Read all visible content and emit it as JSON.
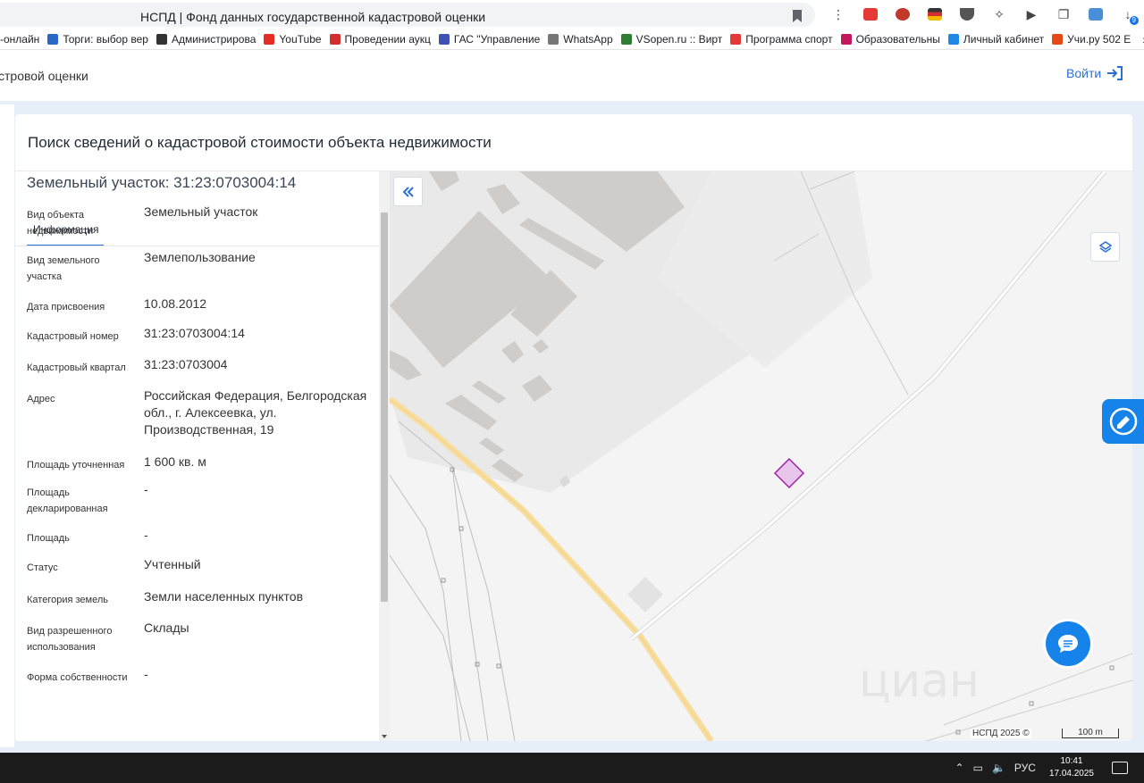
{
  "browser": {
    "tab_title": "НСПД | Фонд данных государственной кадастровой оценки",
    "bookmarks": [
      {
        "label": "-онлайн",
        "color": "#3b7dd8"
      },
      {
        "label": "Торги: выбор вер",
        "color": "#2a68c8"
      },
      {
        "label": "Администрирова",
        "color": "#333333"
      },
      {
        "label": "YouTube",
        "color": "#e52d27"
      },
      {
        "label": "Проведении аукц",
        "color": "#d32f2f"
      },
      {
        "label": "ГАС \"Управление",
        "color": "#3f51b5"
      },
      {
        "label": "WhatsApp",
        "color": "#777777"
      },
      {
        "label": "VSopen.ru :: Вирт",
        "color": "#2e7d32"
      },
      {
        "label": "Программа спорт",
        "color": "#e53935"
      },
      {
        "label": "Образовательны",
        "color": "#c2185b"
      },
      {
        "label": "Личный кабинет",
        "color": "#1e88e5"
      },
      {
        "label": "Учи.ру 502 Е",
        "color": "#e64a19"
      }
    ],
    "more": "»",
    "ext_badge": "9",
    "colors": {
      "accent": "#2b6fd6",
      "chat": "#1583e9"
    }
  },
  "site": {
    "title": "стровой оценки",
    "login": "Войти"
  },
  "page": {
    "title": "Поиск сведений о кадастровой стоимости объекта недвижимости"
  },
  "object": {
    "title": "Земельный участок: 31:23:0703004:14",
    "tab": "Информация",
    "rows": [
      {
        "label": "Вид объекта недвижимости",
        "value": "Земельный участок"
      },
      {
        "label": "Вид земельного участка",
        "value": "Землепользование"
      },
      {
        "label": "Дата присвоения",
        "value": "10.08.2012"
      },
      {
        "label": "Кадастровый номер",
        "value": "31:23:0703004:14"
      },
      {
        "label": "Кадастровый квартал",
        "value": "31:23:0703004"
      },
      {
        "label": "Адрес",
        "value": "Российская Федерация, Белгородская обл., г. Алексеевка, ул. Производственная, 19"
      },
      {
        "label": "Площадь уточненная",
        "value": "1 600 кв. м"
      },
      {
        "label": "Площадь декларированная",
        "value": "-"
      },
      {
        "label": "Площадь",
        "value": "-"
      },
      {
        "label": "Статус",
        "value": "Учтенный"
      },
      {
        "label": "Категория земель",
        "value": "Земли населенных пунктов"
      },
      {
        "label": "Вид разрешенного использования",
        "value": "Склады"
      },
      {
        "label": "Форма собственности",
        "value": "-"
      }
    ]
  },
  "map": {
    "copyright": "НСПД 2025 ©",
    "scale": "100 m",
    "watermark": "циан"
  },
  "taskbar": {
    "lang": "РУС",
    "time": "10:41",
    "date": "17.04.2025"
  }
}
